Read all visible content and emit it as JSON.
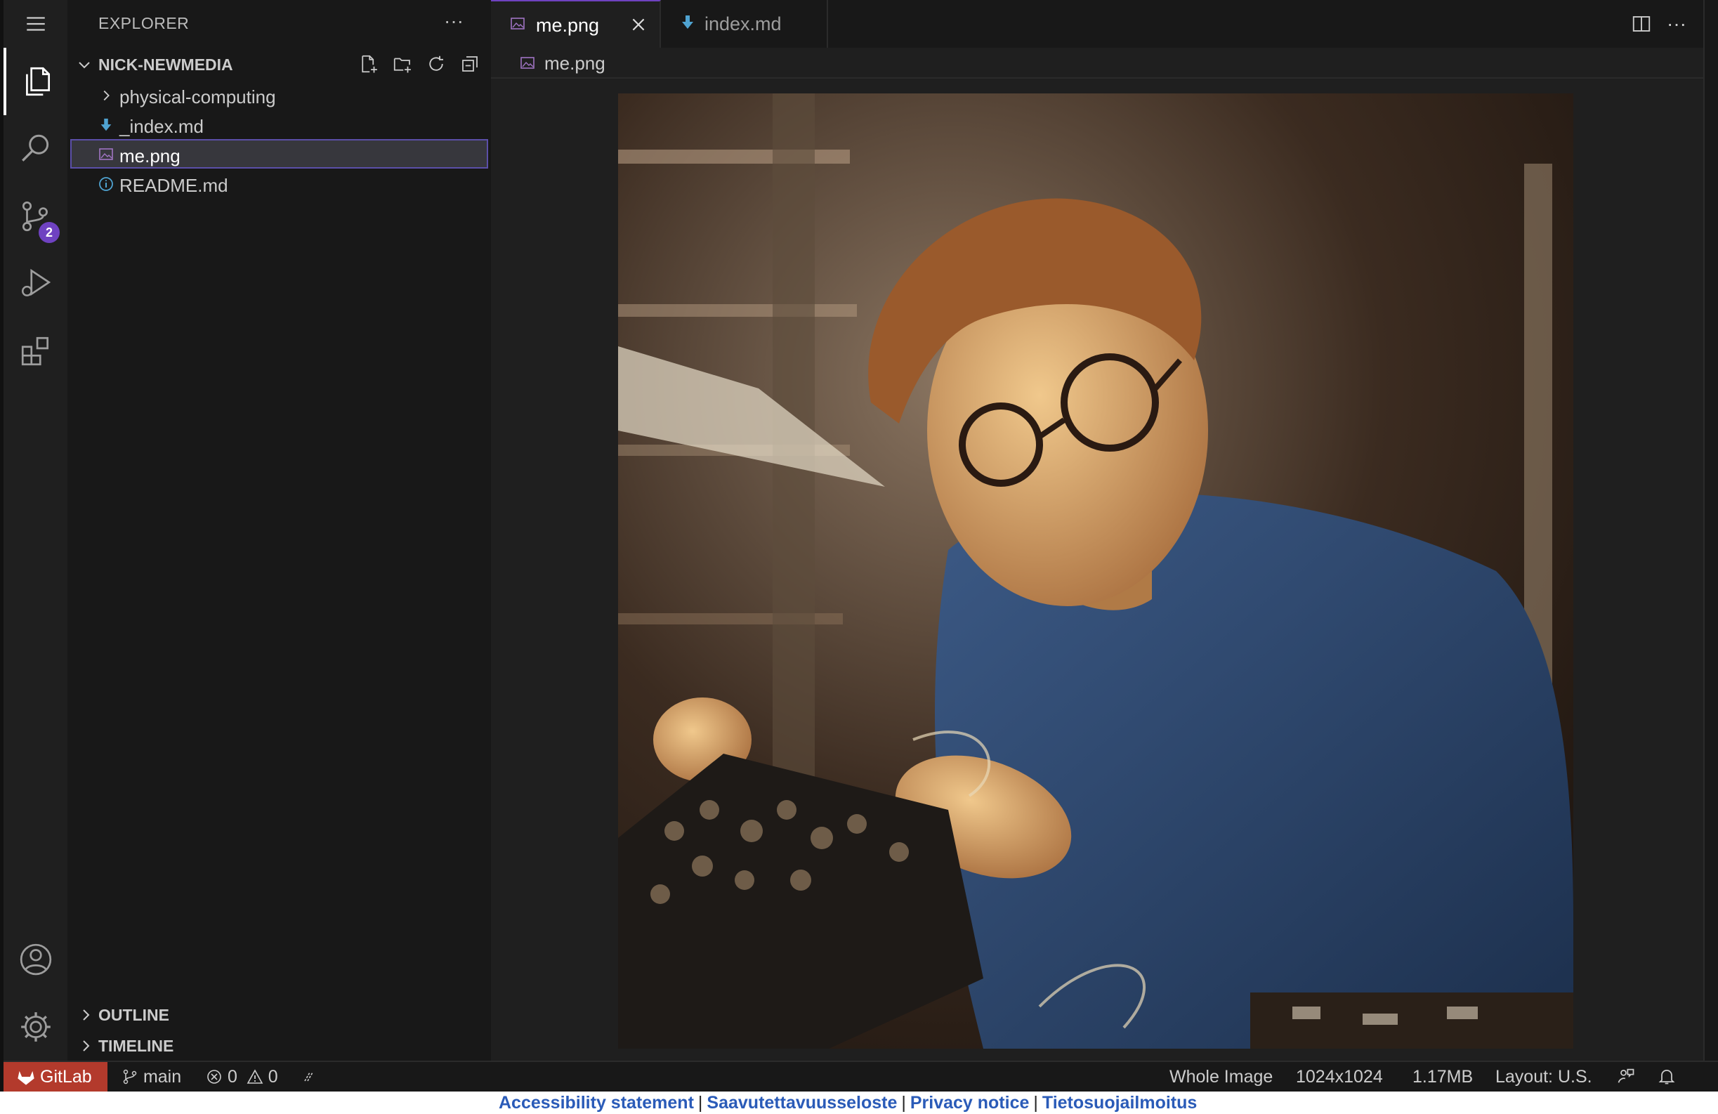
{
  "sidebar": {
    "title": "EXPLORER",
    "workspace": "NICK-NEWMEDIA",
    "items": [
      {
        "label": "physical-computing",
        "kind": "folder"
      },
      {
        "label": "_index.md",
        "kind": "markdown"
      },
      {
        "label": "me.png",
        "kind": "image",
        "selected": true
      },
      {
        "label": "README.md",
        "kind": "info"
      }
    ],
    "sections": {
      "outline": "OUTLINE",
      "timeline": "TIMELINE"
    }
  },
  "activity": {
    "source_control_badge": "2"
  },
  "tabs": [
    {
      "label": "me.png",
      "active": true
    },
    {
      "label": "index.md",
      "active": false
    }
  ],
  "breadcrumb": {
    "file": "me.png"
  },
  "status": {
    "gitlab": "GitLab",
    "branch": "main",
    "errors": "0",
    "warnings": "0",
    "zoom": "Whole Image",
    "dimensions": "1024x1024",
    "size": "1.17MB",
    "layout": "Layout: U.S."
  },
  "footer": {
    "links": [
      "Accessibility statement",
      "Saavutettavuusseloste",
      "Privacy notice",
      "Tietosuojailmoitus"
    ]
  },
  "colors": {
    "accent": "#6f42c1",
    "gitlab": "#b33a2c",
    "link": "#2a5bb8"
  }
}
